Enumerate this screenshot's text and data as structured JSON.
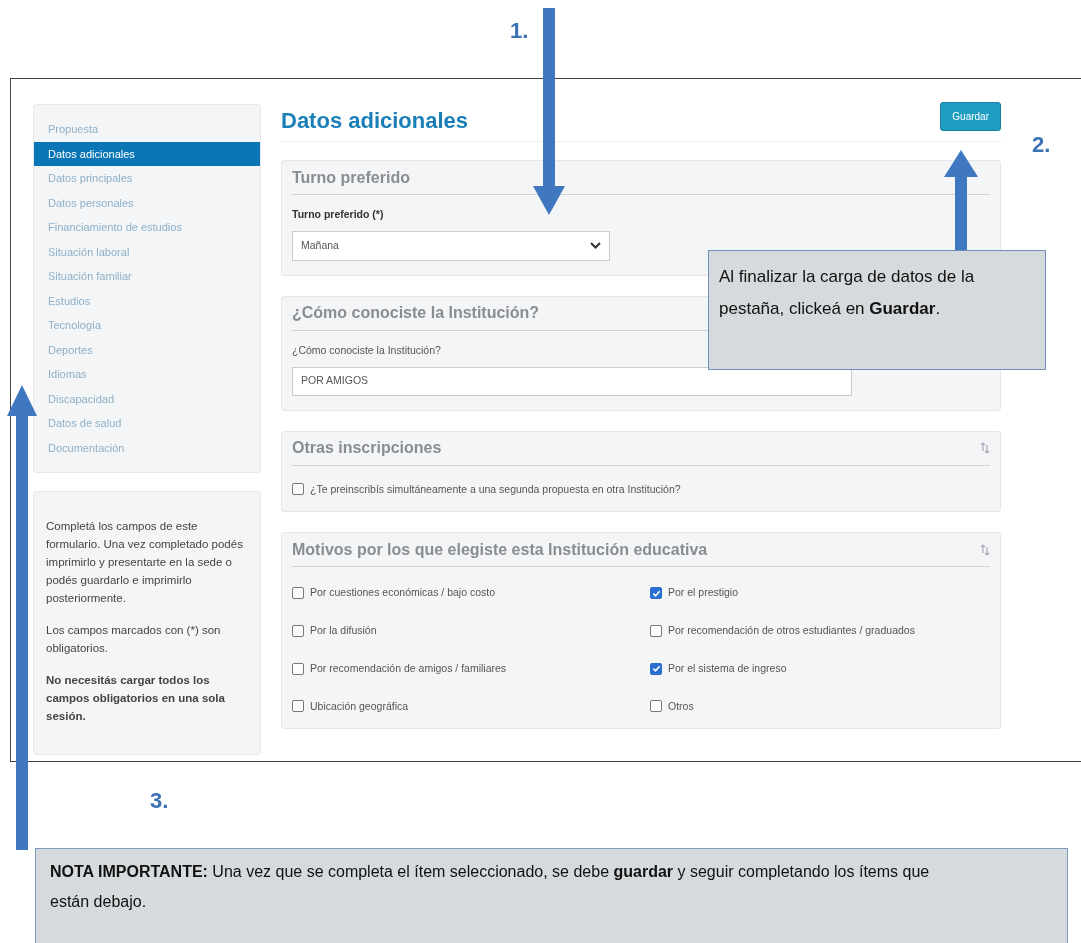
{
  "sidebar": {
    "items": [
      {
        "label": "Propuesta",
        "selected": false
      },
      {
        "label": "Datos adicionales",
        "selected": true
      },
      {
        "label": "Datos principales",
        "selected": false
      },
      {
        "label": "Datos personales",
        "selected": false
      },
      {
        "label": "Financiamiento de estudios",
        "selected": false
      },
      {
        "label": "Situación laboral",
        "selected": false
      },
      {
        "label": "Situación familiar",
        "selected": false
      },
      {
        "label": "Estudios",
        "selected": false
      },
      {
        "label": "Tecnología",
        "selected": false
      },
      {
        "label": "Deportes",
        "selected": false
      },
      {
        "label": "Idiomas",
        "selected": false
      },
      {
        "label": "Discapacidad",
        "selected": false
      },
      {
        "label": "Datos de salud",
        "selected": false
      },
      {
        "label": "Documentación",
        "selected": false
      }
    ],
    "help": [
      {
        "text": "Completá los campos de este formulario. Una vez completado podés imprimirlo y presentarte en la sede o podés guardarlo e imprimirlo posteriormente.",
        "bold": false
      },
      {
        "text": "Los campos marcados con (*) son obligatorios.",
        "bold": false
      },
      {
        "text": "No necesitás cargar todos los campos obligatorios en una sola sesión.",
        "bold": true
      }
    ]
  },
  "page": {
    "title": "Datos adicionales",
    "save_button": "Guardar"
  },
  "sections": [
    {
      "title": "Turno preferido",
      "kind": "select",
      "label": "Turno preferido (*)",
      "value": "Mañana"
    },
    {
      "title": "¿Cómo conociste la Institución?",
      "kind": "text",
      "label": "¿Cómo conociste la Institución?",
      "value": "POR AMIGOS"
    },
    {
      "title": "Otras inscripciones",
      "kind": "checks",
      "options": [
        {
          "label": "¿Te preinscribís simultáneamente a una segunda propuesta en otra Institución?",
          "checked": false
        }
      ]
    },
    {
      "title": "Motivos por los que elegiste esta Institución educativa",
      "kind": "grid",
      "options": [
        {
          "label": "Por cuestiones económicas / bajo costo",
          "checked": false
        },
        {
          "label": "Por el prestigio",
          "checked": true
        },
        {
          "label": "Por la difusión",
          "checked": false
        },
        {
          "label": "Por recomendación de otros estudiantes / graduados",
          "checked": false
        },
        {
          "label": "Por recomendación de amigos / familiares",
          "checked": false
        },
        {
          "label": "Por el sistema de ingreso",
          "checked": true
        },
        {
          "label": "Ubicación geográfica",
          "checked": false
        },
        {
          "label": "Otros",
          "checked": false
        }
      ]
    }
  ],
  "annotations": {
    "markers": [
      "1.",
      "2.",
      "3."
    ],
    "callout": "Al finalizar la carga de datos de la pestaña, clickeá en **Guardar**.",
    "note": "**NOTA IMPORTANTE:** Una vez que se completa el ítem seleccionado, se debe **guardar** y seguir completando los ítems que están debajo."
  }
}
